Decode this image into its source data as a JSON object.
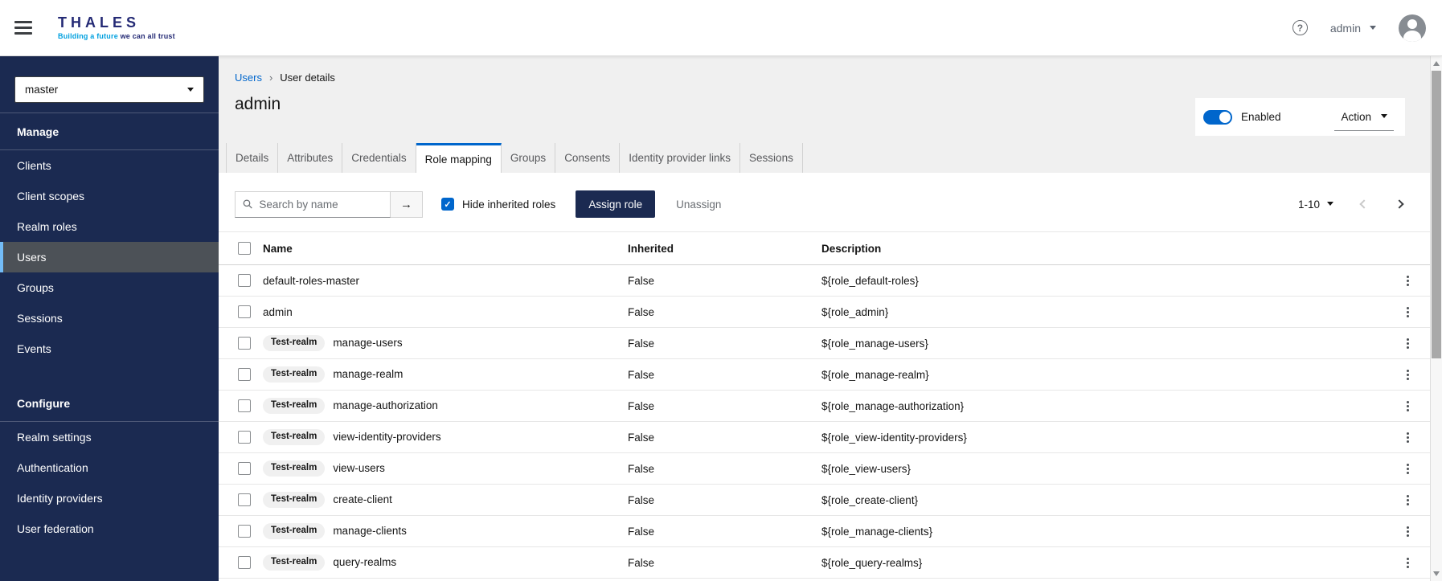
{
  "header": {
    "brand_title": "THALES",
    "brand_tagline_accent": "Building a future",
    "brand_tagline_rest": " we can all trust",
    "user_menu_label": "admin"
  },
  "icons": {
    "help_glyph": "?",
    "search_submit_glyph": "→"
  },
  "sidebar": {
    "realm_selector": {
      "value": "master"
    },
    "sections": [
      {
        "title": "Manage",
        "items": [
          {
            "label": "Clients"
          },
          {
            "label": "Client scopes"
          },
          {
            "label": "Realm roles"
          },
          {
            "label": "Users",
            "active": true
          },
          {
            "label": "Groups"
          },
          {
            "label": "Sessions"
          },
          {
            "label": "Events"
          }
        ]
      },
      {
        "title": "Configure",
        "items": [
          {
            "label": "Realm settings"
          },
          {
            "label": "Authentication"
          },
          {
            "label": "Identity providers"
          },
          {
            "label": "User federation"
          }
        ]
      }
    ]
  },
  "page": {
    "breadcrumb": {
      "root": "Users",
      "current": "User details"
    },
    "title": "admin",
    "enabled_toggle_label": "Enabled",
    "action_menu_label": "Action"
  },
  "tabs": [
    {
      "label": "Details"
    },
    {
      "label": "Attributes"
    },
    {
      "label": "Credentials"
    },
    {
      "label": "Role mapping",
      "active": true
    },
    {
      "label": "Groups"
    },
    {
      "label": "Consents"
    },
    {
      "label": "Identity provider links"
    },
    {
      "label": "Sessions"
    }
  ],
  "toolbar": {
    "search_placeholder": "Search by name",
    "hide_inherited_label": "Hide inherited roles",
    "hide_inherited_checked": true,
    "assign_button": "Assign role",
    "unassign_button": "Unassign",
    "pagination_range": "1-10"
  },
  "table": {
    "columns": {
      "name": "Name",
      "inherited": "Inherited",
      "description": "Description"
    },
    "rows": [
      {
        "name": "default-roles-master",
        "inherited": "False",
        "description": "${role_default-roles}"
      },
      {
        "name": "admin",
        "inherited": "False",
        "description": "${role_admin}"
      },
      {
        "badge": "Test-realm",
        "name": "manage-users",
        "inherited": "False",
        "description": "${role_manage-users}"
      },
      {
        "badge": "Test-realm",
        "name": "manage-realm",
        "inherited": "False",
        "description": "${role_manage-realm}"
      },
      {
        "badge": "Test-realm",
        "name": "manage-authorization",
        "inherited": "False",
        "description": "${role_manage-authorization}"
      },
      {
        "badge": "Test-realm",
        "name": "view-identity-providers",
        "inherited": "False",
        "description": "${role_view-identity-providers}"
      },
      {
        "badge": "Test-realm",
        "name": "view-users",
        "inherited": "False",
        "description": "${role_view-users}"
      },
      {
        "badge": "Test-realm",
        "name": "create-client",
        "inherited": "False",
        "description": "${role_create-client}"
      },
      {
        "badge": "Test-realm",
        "name": "manage-clients",
        "inherited": "False",
        "description": "${role_manage-clients}"
      },
      {
        "badge": "Test-realm",
        "name": "query-realms",
        "inherited": "False",
        "description": "${role_query-realms}"
      }
    ]
  },
  "colors": {
    "sidebar_navy": "#1b2a51",
    "accent_blue": "#0066cc",
    "link_blue": "#0066cc",
    "nav_selected_bg": "#4c5157",
    "nav_selected_border": "#73bcf7",
    "brand_blue": "#242a75",
    "brand_cyan": "#00a0df",
    "page_bg": "#f0f0f0",
    "badge_bg": "#f0f0f0"
  }
}
